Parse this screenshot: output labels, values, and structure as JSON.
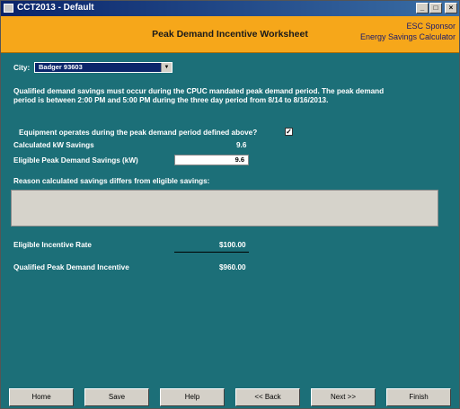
{
  "window": {
    "title": "CCT2013 - Default",
    "controls": [
      "_",
      "□",
      "×"
    ]
  },
  "header": {
    "title": "Peak Demand Incentive Worksheet",
    "sponsor": "ESC Sponsor",
    "subtitle": "Energy Savings Calculator"
  },
  "city": {
    "label": "City:",
    "selected": "Badger 93603",
    "dropdown_glyph": "▼"
  },
  "notice": {
    "line1": "Qualified demand savings must occur during the CPUC mandated peak demand period. The peak demand",
    "line2": "period is between 2:00 PM and 5:00 PM during the three day period from 8/14 to 8/16/2013."
  },
  "equipment": {
    "label": "Equipment operates during the peak demand period defined above?",
    "checked_mark": "✓"
  },
  "calc_kw": {
    "label": "Calculated kW Savings",
    "value": "9.6"
  },
  "eligible_kw": {
    "label": "Eligible Peak Demand Savings (kW)",
    "value": "9.6"
  },
  "reason": {
    "label": "Reason calculated savings differs from eligible savings:"
  },
  "rate": {
    "label": "Eligible Incentive Rate",
    "value": "$100.00"
  },
  "incentive": {
    "label": "Qualified Peak Demand Incentive",
    "value": "$960.00"
  },
  "buttons": {
    "home": "Home",
    "save": "Save",
    "help": "Help",
    "back": "<< Back",
    "next": "Next >>",
    "finish": "Finish"
  }
}
